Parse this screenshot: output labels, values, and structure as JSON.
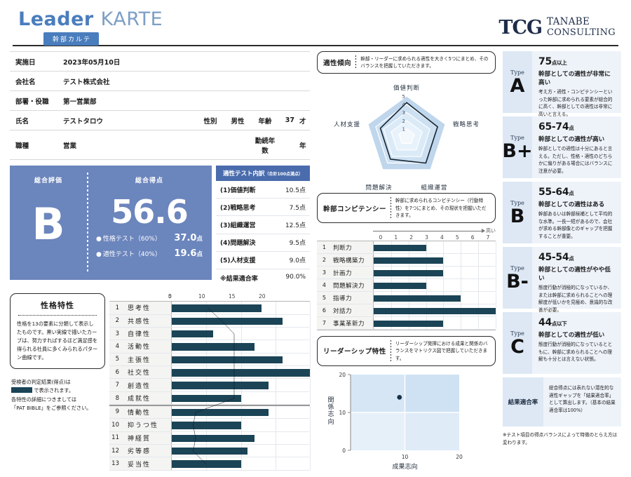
{
  "header": {
    "title_bold": "Leader",
    "title_light": "KARTE",
    "badge": "幹部カルテ",
    "logo_mark": "TCG",
    "logo_line1": "TANABE",
    "logo_line2": "CONSULTING",
    "accent_color": "#4a7dbd"
  },
  "info": {
    "rows": [
      {
        "label": "実施日",
        "value": "2023年05月10日"
      },
      {
        "label": "会社名",
        "value": "テスト株式会社"
      },
      {
        "label": "部署・役職",
        "value": "第一営業部"
      }
    ],
    "name_row": {
      "label": "氏名",
      "value": "テストタロウ",
      "gender_label": "性別",
      "gender_value": "男性",
      "age_label": "年齢",
      "age_value": "37",
      "age_unit": "才"
    },
    "job_row": {
      "label": "職種",
      "value": "営業",
      "tenure_label": "勤続年数",
      "tenure_value": "",
      "tenure_unit": "年"
    }
  },
  "score": {
    "grade_caption": "総合評価",
    "grade": "B",
    "total_caption": "総合得点",
    "total": "56.6",
    "sub": [
      {
        "name": "性格テスト（60%）",
        "value": "37.0",
        "unit": "点"
      },
      {
        "name": "適性テスト（40%）",
        "value": "19.6",
        "unit": "点"
      }
    ],
    "panel_color": "#6b85bd"
  },
  "breakdown": {
    "title": "適性テスト内訳",
    "title_note": "（合計100点満点）",
    "rows": [
      {
        "k": "(1)価値判断",
        "v": "10.5点"
      },
      {
        "k": "(2)戦略思考",
        "v": "7.5点"
      },
      {
        "k": "(3)組織運営",
        "v": "12.5点"
      },
      {
        "k": "(4)問題解決",
        "v": "9.5点"
      },
      {
        "k": "(5)人材支援",
        "v": "9.0点"
      },
      {
        "k": "※結果適合率",
        "v": "90.0%"
      }
    ]
  },
  "personality_note": {
    "title": "性格特性",
    "body": "性格を13の要素に分類して表示したものです。黒い実線で描いたカーブは、努力すればするほど満足感を得られる社員に多くみられるパターン曲線です。",
    "after_line1": "受検者の判定結果(得点)は",
    "after_line2": "で表示されます。",
    "after_line3": "各特性の詳細につきましては",
    "after_line4": "「PAT BIBLE」をご参照ください。"
  },
  "adaptability_callout": {
    "title": "適性傾向",
    "body": "幹部・リーダーに求められる適性を大きく5つにまとめ、そのバランスを把握していただきます。"
  },
  "competency_callout": {
    "title": "幹部コンピテンシー",
    "body": "幹部に求められるコンピテンシー（行動特性）を7つにまとめ、その現状を把握いただきます。"
  },
  "leadership_callout": {
    "title": "リーダーシップ特性",
    "body": "リーダーシップ発揮における成果と関係のバランスをマトリクス図で把握していただきます。"
  },
  "types": [
    {
      "type_label": "Type",
      "grade": "A",
      "range": "75",
      "range_unit": "点以上",
      "headline": "幹部としての適性が非常に高い",
      "desc": "考え方・適性・コンピテンシーといった幹部に求められる要素が総合的に高く、幹部としての適性は非常に高いと言える。"
    },
    {
      "type_label": "Type",
      "grade": "B+",
      "range": "65-74",
      "range_unit": "点",
      "headline": "幹部としての適性が高い",
      "desc": "幹部としての適性は十分にあると言える。ただし、性格・適性のどちらかに偏りがある場合にはバランスに注意が必要。"
    },
    {
      "type_label": "Type",
      "grade": "B",
      "range": "55-64",
      "range_unit": "点",
      "headline": "幹部としての適性はある",
      "desc": "幹部あるいは幹部候補として平均的な水準。一長一短があるので、会社が求める幹部像とのギャップを把握することが重要。"
    },
    {
      "type_label": "Type",
      "grade": "B-",
      "range": "45-54",
      "range_unit": "点",
      "headline": "幹部としての適性がやや低い",
      "desc": "態度行動が消極的になっているか、または幹部に求められることへの理解度が低いかを見極め、意識的な改善が必要。"
    },
    {
      "type_label": "Type",
      "grade": "C",
      "range": "44",
      "range_unit": "点以下",
      "headline": "幹部としての適性が低い",
      "desc": "態度行動が消極的になっているとともに、幹部に求められることへの理解も十分とは言えない状態。"
    }
  ],
  "fit_rate": {
    "label": "結果適合率",
    "desc": "総合得点には表れない潜在的な適性ギャップを「結果適合率」として算出します。（基本の結果適合率は100%）"
  },
  "footer_note": "※テスト項目の得点バランスによって特徴のとらえ方は変わります。",
  "chart_data": [
    {
      "type": "bar",
      "title": "性格特性",
      "orientation": "horizontal",
      "categories": [
        "思考性",
        "共感性",
        "自律性",
        "活動性",
        "主張性",
        "社交性",
        "創造性",
        "成就性",
        "情動性",
        "抑うつ性",
        "神経質",
        "劣等感",
        "妥当性"
      ],
      "indices": [
        "1",
        "2",
        "3",
        "4",
        "5",
        "6",
        "7",
        "8",
        "9",
        "10",
        "11",
        "12",
        "13"
      ],
      "values": [
        13,
        16,
        6,
        12,
        16,
        20,
        14,
        10,
        14,
        10,
        12,
        11,
        10
      ],
      "xticks": [
        "0",
        "5",
        "10",
        "15",
        "20"
      ],
      "xlim": [
        0,
        20
      ],
      "bar_color": "#1b4456",
      "reference_curve": [
        10.5,
        14.5,
        18,
        18,
        18,
        18,
        18,
        18,
        7,
        6.3,
        7,
        6.3,
        10
      ],
      "curve_color": "#111111"
    },
    {
      "type": "radar",
      "title": "適性傾向",
      "axes": [
        "価値判断",
        "戦略思考",
        "組織運営",
        "問題解決",
        "人材支援"
      ],
      "values": [
        4.2,
        4.0,
        4.0,
        3.4,
        3.4
      ],
      "rticks": [
        "1",
        "2",
        "3",
        "4",
        "5"
      ],
      "rlim": [
        0,
        5
      ],
      "fill_color": "#cfe0f0",
      "line_color": "#16232f"
    },
    {
      "type": "bar",
      "title": "幹部コンピテンシー",
      "orientation": "horizontal",
      "axis_note": "高い",
      "categories": [
        "判断力",
        "戦略構築力",
        "計画力",
        "問題解決力",
        "指導力",
        "対話力",
        "事業革新力"
      ],
      "indices": [
        "1",
        "2",
        "3",
        "4",
        "5",
        "6",
        "7"
      ],
      "values": [
        3,
        4,
        4,
        3,
        5,
        7,
        4
      ],
      "xticks": [
        "0",
        "1",
        "2",
        "3",
        "4",
        "5",
        "6",
        "7"
      ],
      "xlim": [
        0,
        7
      ],
      "bar_color": "#1b4456"
    },
    {
      "type": "scatter",
      "title": "リーダーシップ特性",
      "xlabel": "成果志向",
      "ylabel": "関係志向",
      "xticks": [
        "0",
        "10",
        "20"
      ],
      "yticks": [
        "0",
        "10",
        "20"
      ],
      "xlim": [
        0,
        20
      ],
      "ylim": [
        0,
        20
      ],
      "points": [
        {
          "x": 9,
          "y": 14
        }
      ],
      "point_color": "#16324a"
    }
  ]
}
